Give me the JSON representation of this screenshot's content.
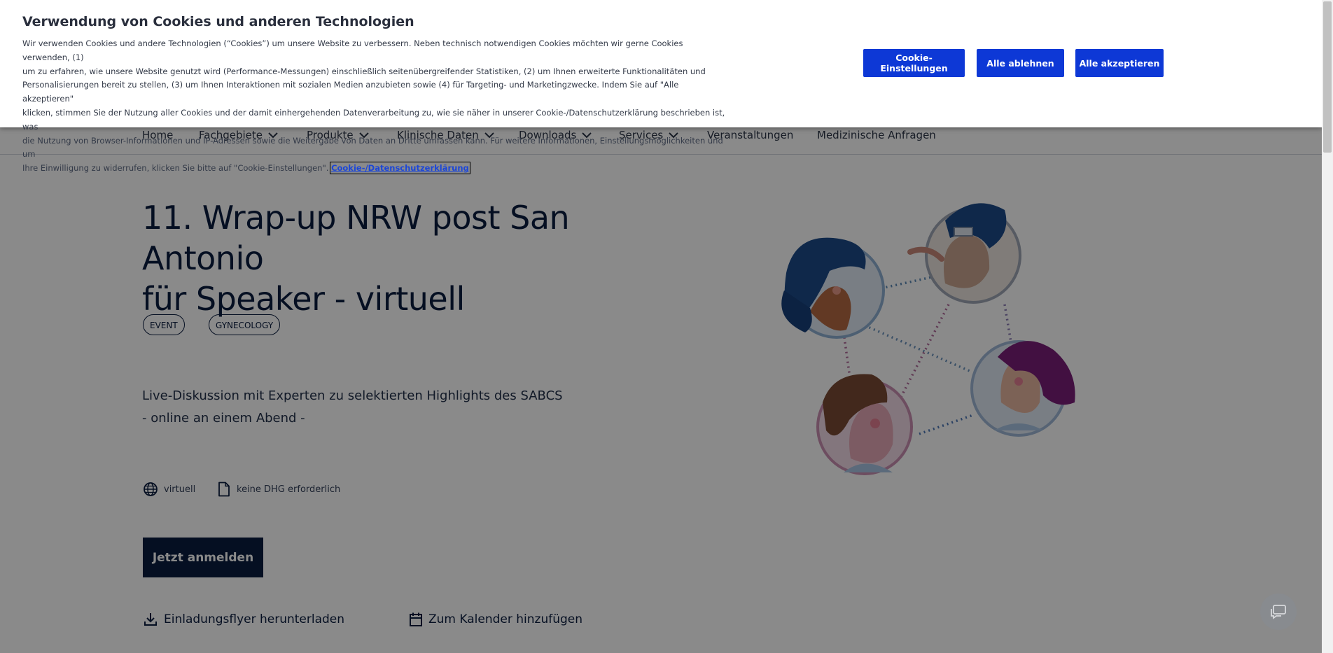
{
  "cookie_banner": {
    "title": "Verwendung von Cookies und anderen Technologien",
    "text_lines": [
      "Wir verwenden Cookies und andere Technologien (“Cookies”) um unsere Website zu verbessern. Neben technisch notwendigen Cookies möchten wir gerne Cookies verwenden, (1)",
      "um zu erfahren, wie unsere Website genutzt wird (Performance-Messungen) einschließlich seitenübergreifender Statistiken, (2) um Ihnen erweiterte Funktionalitäten und",
      "Personalisierungen bereit zu stellen, (3) um Ihnen Interaktionen mit sozialen Medien anzubieten sowie (4) für Targeting- und Marketingzwecke. Indem Sie auf \"Alle akzeptieren\"",
      "klicken, stimmen Sie der Nutzung aller Cookies und der damit einhergehenden Datenverarbeitung zu, wie sie näher in unserer Cookie-/Datenschutzerklärung beschrieben ist, was",
      "die Nutzung von Browser-Informationen und IP-Adressen sowie die Weitergabe von Daten an Dritte umfassen kann. Für weitere Informationen, Einstellungsmöglichkeiten und um",
      "Ihre Einwilligung zu widerrufen, klicken Sie bitte auf \"Cookie-Einstellungen\"."
    ],
    "policy_link": "Cookie-/Datenschutzerklärung",
    "buttons": {
      "settings": "Cookie-Einstellungen",
      "reject": "Alle ablehnen",
      "accept": "Alle akzeptieren"
    },
    "button_color": "#0d38d6"
  },
  "nav": {
    "items": [
      {
        "label": "Home",
        "has_dropdown": false
      },
      {
        "label": "Fachgebiete",
        "has_dropdown": true
      },
      {
        "label": "Produkte",
        "has_dropdown": true
      },
      {
        "label": "Klinische Daten",
        "has_dropdown": true
      },
      {
        "label": "Downloads",
        "has_dropdown": true
      },
      {
        "label": "Services",
        "has_dropdown": true
      },
      {
        "label": "Veranstaltungen",
        "has_dropdown": false
      },
      {
        "label": "Medizinische Anfragen",
        "has_dropdown": false
      }
    ]
  },
  "event": {
    "title_line1": "11. Wrap-up NRW post San Antonio",
    "title_line2": "für Speaker - virtuell",
    "tags": [
      "EVENT",
      "GYNECOLOGY"
    ],
    "description_line1": "Live-Diskussion mit Experten zu selektierten Highlights des SABCS",
    "description_line2": "- online an einem Abend -",
    "location": "virtuell",
    "location_icon": "globe-icon",
    "credits": "keine DHG erforderlich",
    "credits_icon": "document-icon",
    "register_button": "Jetzt anmelden",
    "download_flyer": "Einladungsflyer herunterladen",
    "add_calendar": "Zum Kalender hinzufügen",
    "primary_color": "#0b1d3f"
  },
  "chat": {
    "icon": "chat-icon"
  }
}
